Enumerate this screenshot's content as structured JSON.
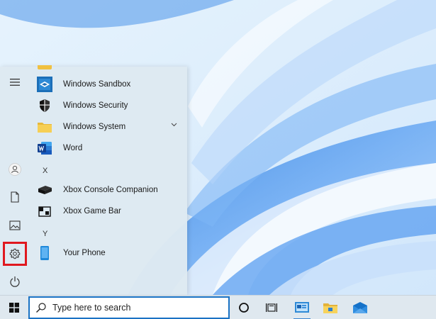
{
  "start_menu": {
    "apps": [
      {
        "label": "Windows Sandbox",
        "icon": "windows-sandbox-icon"
      },
      {
        "label": "Windows Security",
        "icon": "shield-icon"
      },
      {
        "label": "Windows System",
        "icon": "folder-icon",
        "expandable": true
      },
      {
        "label": "Word",
        "icon": "word-icon"
      },
      {
        "label": "Xbox Console Companion",
        "icon": "xbox-console-icon"
      },
      {
        "label": "Xbox Game Bar",
        "icon": "xbox-game-bar-icon"
      },
      {
        "label": "Your Phone",
        "icon": "phone-icon"
      }
    ],
    "group_letters": [
      "X",
      "Y"
    ],
    "rail": [
      "hamburger-menu-icon",
      "user-account-icon",
      "documents-icon",
      "pictures-icon",
      "settings-gear-icon",
      "power-icon"
    ],
    "highlight_color": "#e0181f"
  },
  "taskbar": {
    "search_placeholder": "Type here to search",
    "accent": "#1a72c4",
    "icons": [
      "windows-start-icon",
      "cortana-icon",
      "task-view-icon",
      "control-panel-icon",
      "file-explorer-icon",
      "mail-icon"
    ]
  }
}
